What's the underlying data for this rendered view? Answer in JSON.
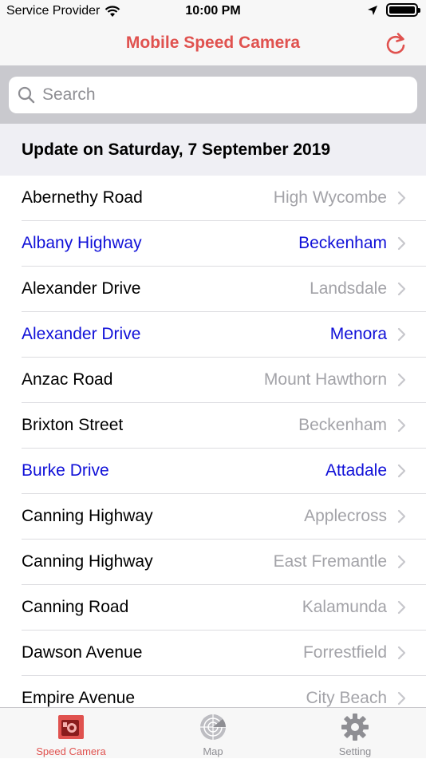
{
  "status": {
    "carrier": "Service Provider",
    "time": "10:00 PM"
  },
  "nav": {
    "title": "Mobile Speed Camera"
  },
  "search": {
    "placeholder": "Search",
    "value": ""
  },
  "section": {
    "header": "Update on Saturday, 7 September 2019"
  },
  "list": {
    "rows": [
      {
        "street": "Abernethy Road",
        "suburb": "High Wycombe",
        "highlight": false
      },
      {
        "street": "Albany Highway",
        "suburb": "Beckenham",
        "highlight": true
      },
      {
        "street": "Alexander Drive",
        "suburb": "Landsdale",
        "highlight": false
      },
      {
        "street": "Alexander Drive",
        "suburb": "Menora",
        "highlight": true
      },
      {
        "street": "Anzac Road",
        "suburb": "Mount Hawthorn",
        "highlight": false
      },
      {
        "street": "Brixton Street",
        "suburb": "Beckenham",
        "highlight": false
      },
      {
        "street": "Burke Drive",
        "suburb": "Attadale",
        "highlight": true
      },
      {
        "street": "Canning Highway",
        "suburb": "Applecross",
        "highlight": false
      },
      {
        "street": "Canning Highway",
        "suburb": "East Fremantle",
        "highlight": false
      },
      {
        "street": "Canning Road",
        "suburb": "Kalamunda",
        "highlight": false
      },
      {
        "street": "Dawson Avenue",
        "suburb": "Forrestfield",
        "highlight": false
      },
      {
        "street": "Empire Avenue",
        "suburb": "City Beach",
        "highlight": false
      }
    ]
  },
  "tabs": [
    {
      "label": "Speed Camera",
      "icon": "speed-camera-icon",
      "active": true
    },
    {
      "label": "Map",
      "icon": "radar-icon",
      "active": false
    },
    {
      "label": "Setting",
      "icon": "gear-icon",
      "active": false
    }
  ],
  "colors": {
    "accent": "#e0524f",
    "highlight": "#1010d8",
    "secondary": "#a3a3a8"
  }
}
